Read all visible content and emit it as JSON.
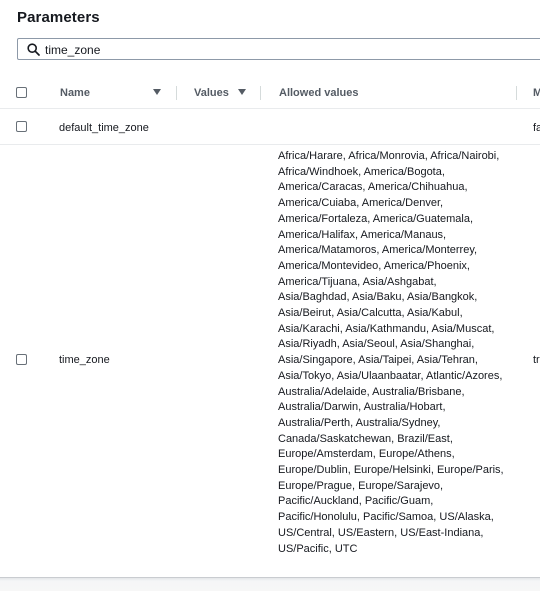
{
  "panel": {
    "title": "Parameters"
  },
  "search": {
    "value": "time_zone"
  },
  "table": {
    "headers": {
      "name": "Name",
      "values": "Values",
      "allowed_values": "Allowed values",
      "modifiable": "M"
    },
    "rows": [
      {
        "name": "default_time_zone",
        "allowed_values": "",
        "modifiable": "fa"
      },
      {
        "name": "time_zone",
        "allowed_values": "Africa/Harare, Africa/Monrovia, Africa/Nairobi, Africa/Windhoek, America/Bogota, America/Caracas, America/Chihuahua, America/Cuiaba, America/Denver, America/Fortaleza, America/Guatemala, America/Halifax, America/Manaus, America/Matamoros, America/Monterrey, America/Montevideo, America/Phoenix, America/Tijuana, Asia/Ashgabat, Asia/Baghdad, Asia/Baku, Asia/Bangkok, Asia/Beirut, Asia/Calcutta, Asia/Kabul, Asia/Karachi, Asia/Kathmandu, Asia/Muscat, Asia/Riyadh, Asia/Seoul, Asia/Shanghai, Asia/Singapore, Asia/Taipei, Asia/Tehran, Asia/Tokyo, Asia/Ulaanbaatar, Atlantic/Azores, Australia/Adelaide, Australia/Brisbane, Australia/Darwin, Australia/Hobart, Australia/Perth, Australia/Sydney, Canada/Saskatchewan, Brazil/East, Europe/Amsterdam, Europe/Athens, Europe/Dublin, Europe/Helsinki, Europe/Paris, Europe/Prague, Europe/Sarajevo, Pacific/Auckland, Pacific/Guam, Pacific/Honolulu, Pacific/Samoa, US/Alaska, US/Central, US/Eastern, US/East-Indiana, US/Pacific, UTC",
        "modifiable": "tr"
      }
    ]
  },
  "icons": {
    "search": "search-icon",
    "sort_name": "caret-down-icon",
    "sort_values": "caret-down-icon"
  },
  "colors": {
    "header_text": "#545b64",
    "text": "#16191f",
    "border": "#e9ebed"
  }
}
